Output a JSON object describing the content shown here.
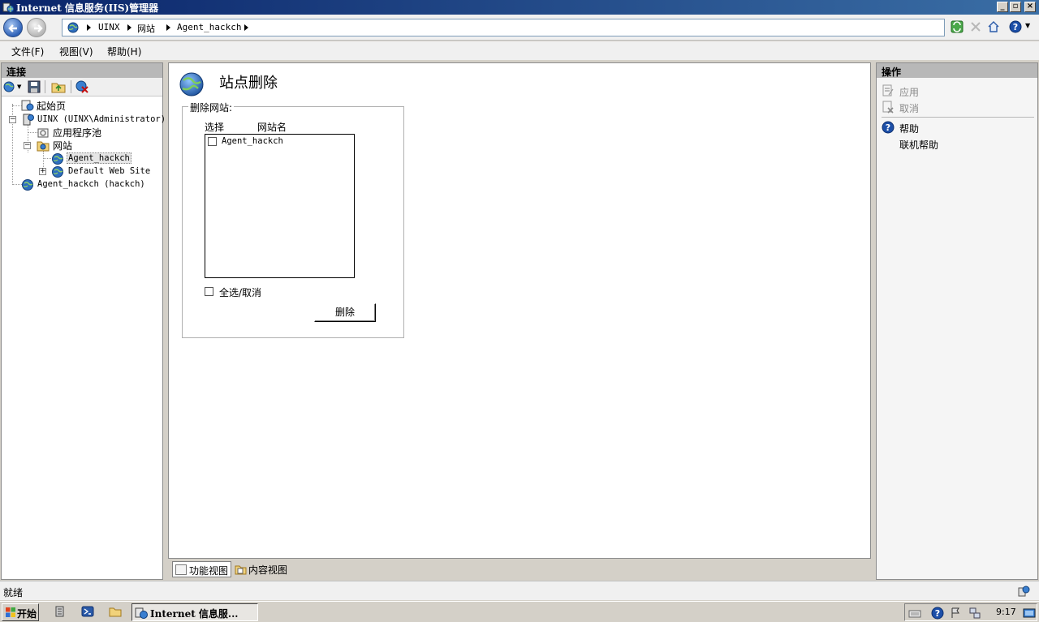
{
  "window": {
    "title": "Internet 信息服务(IIS)管理器"
  },
  "address": {
    "crumbs": [
      "UINX",
      "网站",
      "Agent_hackch"
    ]
  },
  "menu": {
    "items": [
      "文件(F)",
      "视图(V)",
      "帮助(H)"
    ]
  },
  "connections": {
    "header": "连接",
    "tree": {
      "start_page": "起始页",
      "server": "UINX (UINX\\Administrator)",
      "app_pools": "应用程序池",
      "sites": "网站",
      "site_agent": "Agent_hackch",
      "site_default": "Default Web Site",
      "remote_server": "Agent_hackch (hackch)"
    }
  },
  "main": {
    "title": "站点删除",
    "group_legend": "删除网站:",
    "col_select": "选择",
    "col_site_name": "网站名",
    "sites": [
      {
        "name": "Agent_hackch",
        "checked": false
      }
    ],
    "select_all_label": "全选/取消",
    "delete_label": "删除"
  },
  "view_tabs": {
    "features": "功能视图",
    "content": "内容视图"
  },
  "actions": {
    "header": "操作",
    "apply": "应用",
    "cancel": "取消",
    "help": "帮助",
    "online_help": "联机帮助"
  },
  "status": {
    "text": "就绪"
  },
  "taskbar": {
    "start": "开始",
    "task_item": "Internet 信息服...",
    "clock": "9:17"
  },
  "colors": {
    "title_bar": "#0a246a",
    "panel_header": "#b8b8b8",
    "help_icon": "#1c4fa8"
  }
}
